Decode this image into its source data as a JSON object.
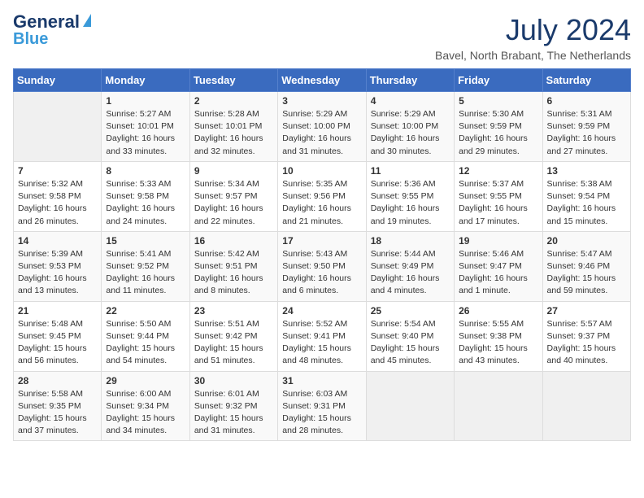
{
  "header": {
    "logo_line1": "General",
    "logo_line2": "Blue",
    "month_year": "July 2024",
    "location": "Bavel, North Brabant, The Netherlands"
  },
  "days_of_week": [
    "Sunday",
    "Monday",
    "Tuesday",
    "Wednesday",
    "Thursday",
    "Friday",
    "Saturday"
  ],
  "weeks": [
    [
      {
        "day": "",
        "info": ""
      },
      {
        "day": "1",
        "info": "Sunrise: 5:27 AM\nSunset: 10:01 PM\nDaylight: 16 hours\nand 33 minutes."
      },
      {
        "day": "2",
        "info": "Sunrise: 5:28 AM\nSunset: 10:01 PM\nDaylight: 16 hours\nand 32 minutes."
      },
      {
        "day": "3",
        "info": "Sunrise: 5:29 AM\nSunset: 10:00 PM\nDaylight: 16 hours\nand 31 minutes."
      },
      {
        "day": "4",
        "info": "Sunrise: 5:29 AM\nSunset: 10:00 PM\nDaylight: 16 hours\nand 30 minutes."
      },
      {
        "day": "5",
        "info": "Sunrise: 5:30 AM\nSunset: 9:59 PM\nDaylight: 16 hours\nand 29 minutes."
      },
      {
        "day": "6",
        "info": "Sunrise: 5:31 AM\nSunset: 9:59 PM\nDaylight: 16 hours\nand 27 minutes."
      }
    ],
    [
      {
        "day": "7",
        "info": "Sunrise: 5:32 AM\nSunset: 9:58 PM\nDaylight: 16 hours\nand 26 minutes."
      },
      {
        "day": "8",
        "info": "Sunrise: 5:33 AM\nSunset: 9:58 PM\nDaylight: 16 hours\nand 24 minutes."
      },
      {
        "day": "9",
        "info": "Sunrise: 5:34 AM\nSunset: 9:57 PM\nDaylight: 16 hours\nand 22 minutes."
      },
      {
        "day": "10",
        "info": "Sunrise: 5:35 AM\nSunset: 9:56 PM\nDaylight: 16 hours\nand 21 minutes."
      },
      {
        "day": "11",
        "info": "Sunrise: 5:36 AM\nSunset: 9:55 PM\nDaylight: 16 hours\nand 19 minutes."
      },
      {
        "day": "12",
        "info": "Sunrise: 5:37 AM\nSunset: 9:55 PM\nDaylight: 16 hours\nand 17 minutes."
      },
      {
        "day": "13",
        "info": "Sunrise: 5:38 AM\nSunset: 9:54 PM\nDaylight: 16 hours\nand 15 minutes."
      }
    ],
    [
      {
        "day": "14",
        "info": "Sunrise: 5:39 AM\nSunset: 9:53 PM\nDaylight: 16 hours\nand 13 minutes."
      },
      {
        "day": "15",
        "info": "Sunrise: 5:41 AM\nSunset: 9:52 PM\nDaylight: 16 hours\nand 11 minutes."
      },
      {
        "day": "16",
        "info": "Sunrise: 5:42 AM\nSunset: 9:51 PM\nDaylight: 16 hours\nand 8 minutes."
      },
      {
        "day": "17",
        "info": "Sunrise: 5:43 AM\nSunset: 9:50 PM\nDaylight: 16 hours\nand 6 minutes."
      },
      {
        "day": "18",
        "info": "Sunrise: 5:44 AM\nSunset: 9:49 PM\nDaylight: 16 hours\nand 4 minutes."
      },
      {
        "day": "19",
        "info": "Sunrise: 5:46 AM\nSunset: 9:47 PM\nDaylight: 16 hours\nand 1 minute."
      },
      {
        "day": "20",
        "info": "Sunrise: 5:47 AM\nSunset: 9:46 PM\nDaylight: 15 hours\nand 59 minutes."
      }
    ],
    [
      {
        "day": "21",
        "info": "Sunrise: 5:48 AM\nSunset: 9:45 PM\nDaylight: 15 hours\nand 56 minutes."
      },
      {
        "day": "22",
        "info": "Sunrise: 5:50 AM\nSunset: 9:44 PM\nDaylight: 15 hours\nand 54 minutes."
      },
      {
        "day": "23",
        "info": "Sunrise: 5:51 AM\nSunset: 9:42 PM\nDaylight: 15 hours\nand 51 minutes."
      },
      {
        "day": "24",
        "info": "Sunrise: 5:52 AM\nSunset: 9:41 PM\nDaylight: 15 hours\nand 48 minutes."
      },
      {
        "day": "25",
        "info": "Sunrise: 5:54 AM\nSunset: 9:40 PM\nDaylight: 15 hours\nand 45 minutes."
      },
      {
        "day": "26",
        "info": "Sunrise: 5:55 AM\nSunset: 9:38 PM\nDaylight: 15 hours\nand 43 minutes."
      },
      {
        "day": "27",
        "info": "Sunrise: 5:57 AM\nSunset: 9:37 PM\nDaylight: 15 hours\nand 40 minutes."
      }
    ],
    [
      {
        "day": "28",
        "info": "Sunrise: 5:58 AM\nSunset: 9:35 PM\nDaylight: 15 hours\nand 37 minutes."
      },
      {
        "day": "29",
        "info": "Sunrise: 6:00 AM\nSunset: 9:34 PM\nDaylight: 15 hours\nand 34 minutes."
      },
      {
        "day": "30",
        "info": "Sunrise: 6:01 AM\nSunset: 9:32 PM\nDaylight: 15 hours\nand 31 minutes."
      },
      {
        "day": "31",
        "info": "Sunrise: 6:03 AM\nSunset: 9:31 PM\nDaylight: 15 hours\nand 28 minutes."
      },
      {
        "day": "",
        "info": ""
      },
      {
        "day": "",
        "info": ""
      },
      {
        "day": "",
        "info": ""
      }
    ]
  ]
}
